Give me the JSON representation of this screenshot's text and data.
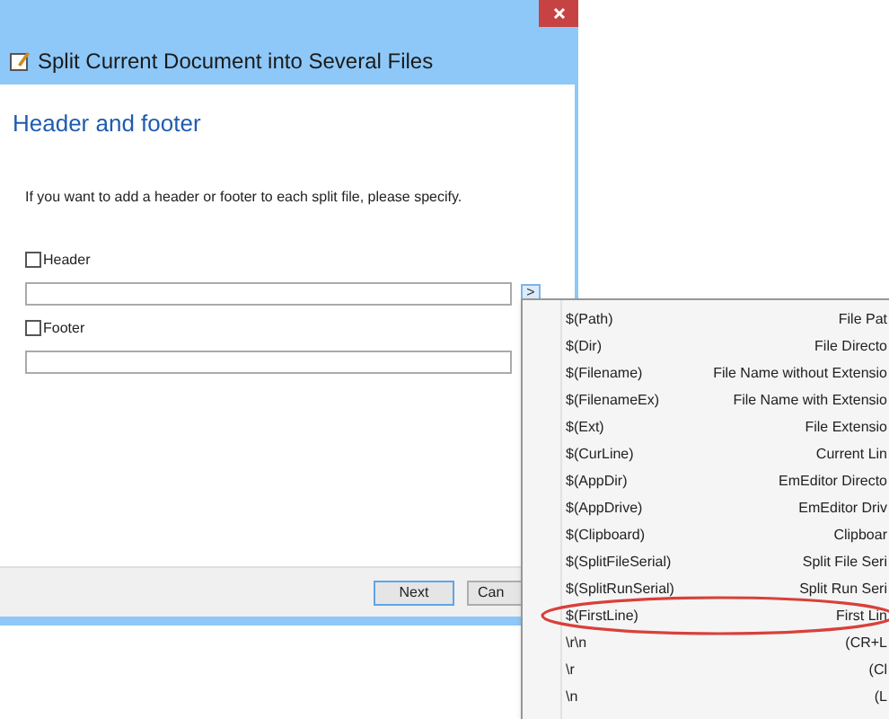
{
  "window": {
    "title": "Split Current Document into Several Files"
  },
  "heading": "Header and footer",
  "description": "If you want to add a header or footer to each split file, please specify.",
  "fields": [
    {
      "label": "Header",
      "checked": false,
      "menu_button": ">"
    },
    {
      "label": "Footer",
      "checked": false
    }
  ],
  "buttons": [
    {
      "label": "Next",
      "default": true
    },
    {
      "label": "Can",
      "default": false
    }
  ],
  "menu": {
    "items": [
      {
        "macro": "$(Path)",
        "description": "File Pat",
        "highlighted": false
      },
      {
        "macro": "$(Dir)",
        "description": "File Directo",
        "highlighted": false
      },
      {
        "macro": "$(Filename)",
        "description": "File Name without Extensio",
        "highlighted": false
      },
      {
        "macro": "$(FilenameEx)",
        "description": "File Name with Extensio",
        "highlighted": false
      },
      {
        "macro": "$(Ext)",
        "description": "File Extensio",
        "highlighted": false
      },
      {
        "macro": "$(CurLine)",
        "description": "Current Lin",
        "highlighted": false
      },
      {
        "macro": "$(AppDir)",
        "description": "EmEditor Directo",
        "highlighted": false
      },
      {
        "macro": "$(AppDrive)",
        "description": "EmEditor Driv",
        "highlighted": false
      },
      {
        "macro": "$(Clipboard)",
        "description": "Clipboar",
        "highlighted": false
      },
      {
        "macro": "$(SplitFileSerial)",
        "description": "Split File Seri",
        "highlighted": false
      },
      {
        "macro": "$(SplitRunSerial)",
        "description": "Split Run Seri",
        "highlighted": false
      },
      {
        "macro": "$(FirstLine)",
        "description": "First Lin",
        "highlighted": true
      },
      {
        "macro": "\\r\\n",
        "description": "(CR+L",
        "highlighted": false
      },
      {
        "macro": "\\r",
        "description": "(Cl",
        "highlighted": false
      },
      {
        "macro": "\\n",
        "description": "(L",
        "highlighted": false
      }
    ]
  }
}
